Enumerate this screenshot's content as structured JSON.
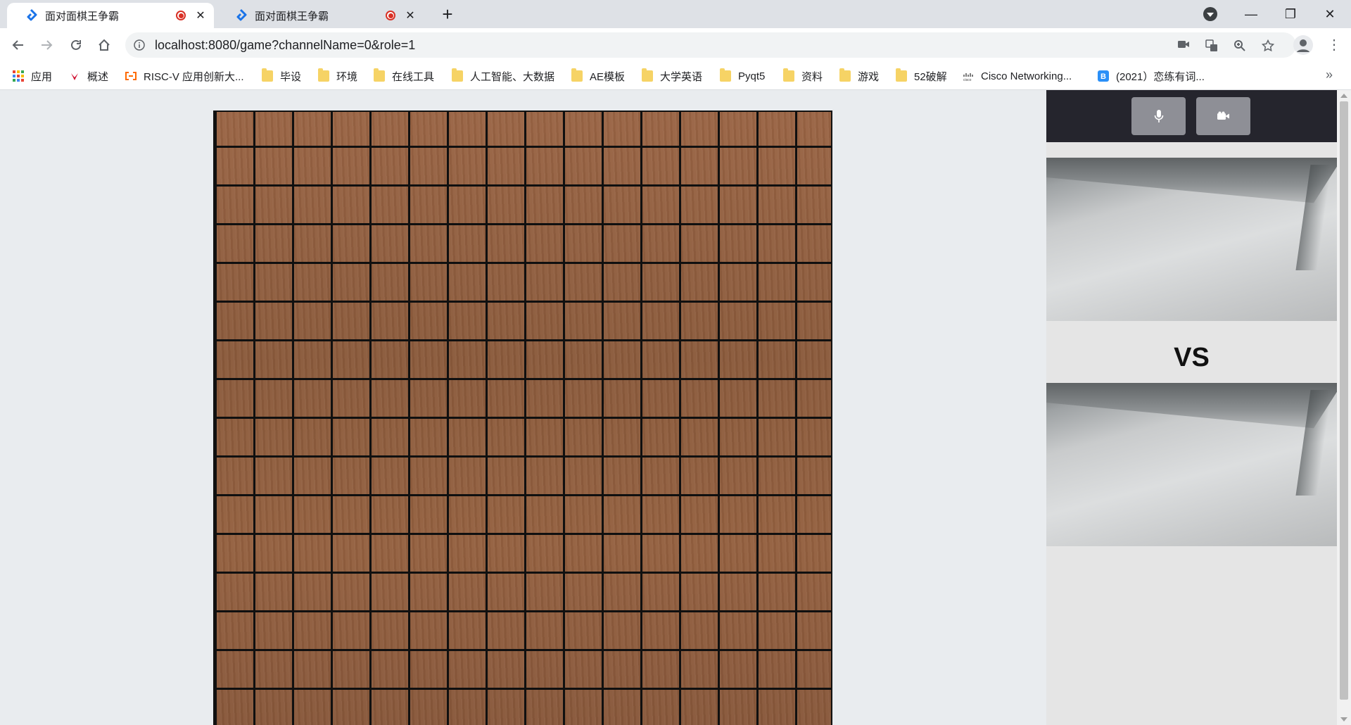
{
  "tabs": [
    {
      "title": "面对面棋王争霸",
      "active": true
    },
    {
      "title": "面对面棋王争霸",
      "active": false
    }
  ],
  "address": {
    "url": "localhost:8080/game?channelName=0&role=1"
  },
  "bookmarks": [
    {
      "label": "应用",
      "icon": "apps-grid-icon"
    },
    {
      "label": "概述",
      "icon": "huawei-icon"
    },
    {
      "label": "RISC-V 应用创新大...",
      "icon": "aliyun-icon"
    },
    {
      "label": "毕设",
      "icon": "folder-icon"
    },
    {
      "label": "环境",
      "icon": "folder-icon"
    },
    {
      "label": "在线工具",
      "icon": "folder-icon"
    },
    {
      "label": "人工智能、大数据",
      "icon": "folder-icon"
    },
    {
      "label": "AE模板",
      "icon": "folder-icon"
    },
    {
      "label": "大学英语",
      "icon": "folder-icon"
    },
    {
      "label": "Pyqt5",
      "icon": "folder-icon"
    },
    {
      "label": "资料",
      "icon": "folder-icon"
    },
    {
      "label": "游戏",
      "icon": "folder-icon"
    },
    {
      "label": "52破解",
      "icon": "folder-icon"
    },
    {
      "label": "Cisco Networking...",
      "icon": "cisco-icon"
    },
    {
      "label": "(2021）恋练有词...",
      "icon": "bilibili-icon"
    }
  ],
  "game": {
    "vs_label": "VS",
    "board_grid": 16
  },
  "colors": {
    "tabstrip": "#dee1e6",
    "page_bg": "#e9ecef",
    "board_wood": "#8b5a3c",
    "controls_bg": "#25252d",
    "record_red": "#d93025"
  }
}
